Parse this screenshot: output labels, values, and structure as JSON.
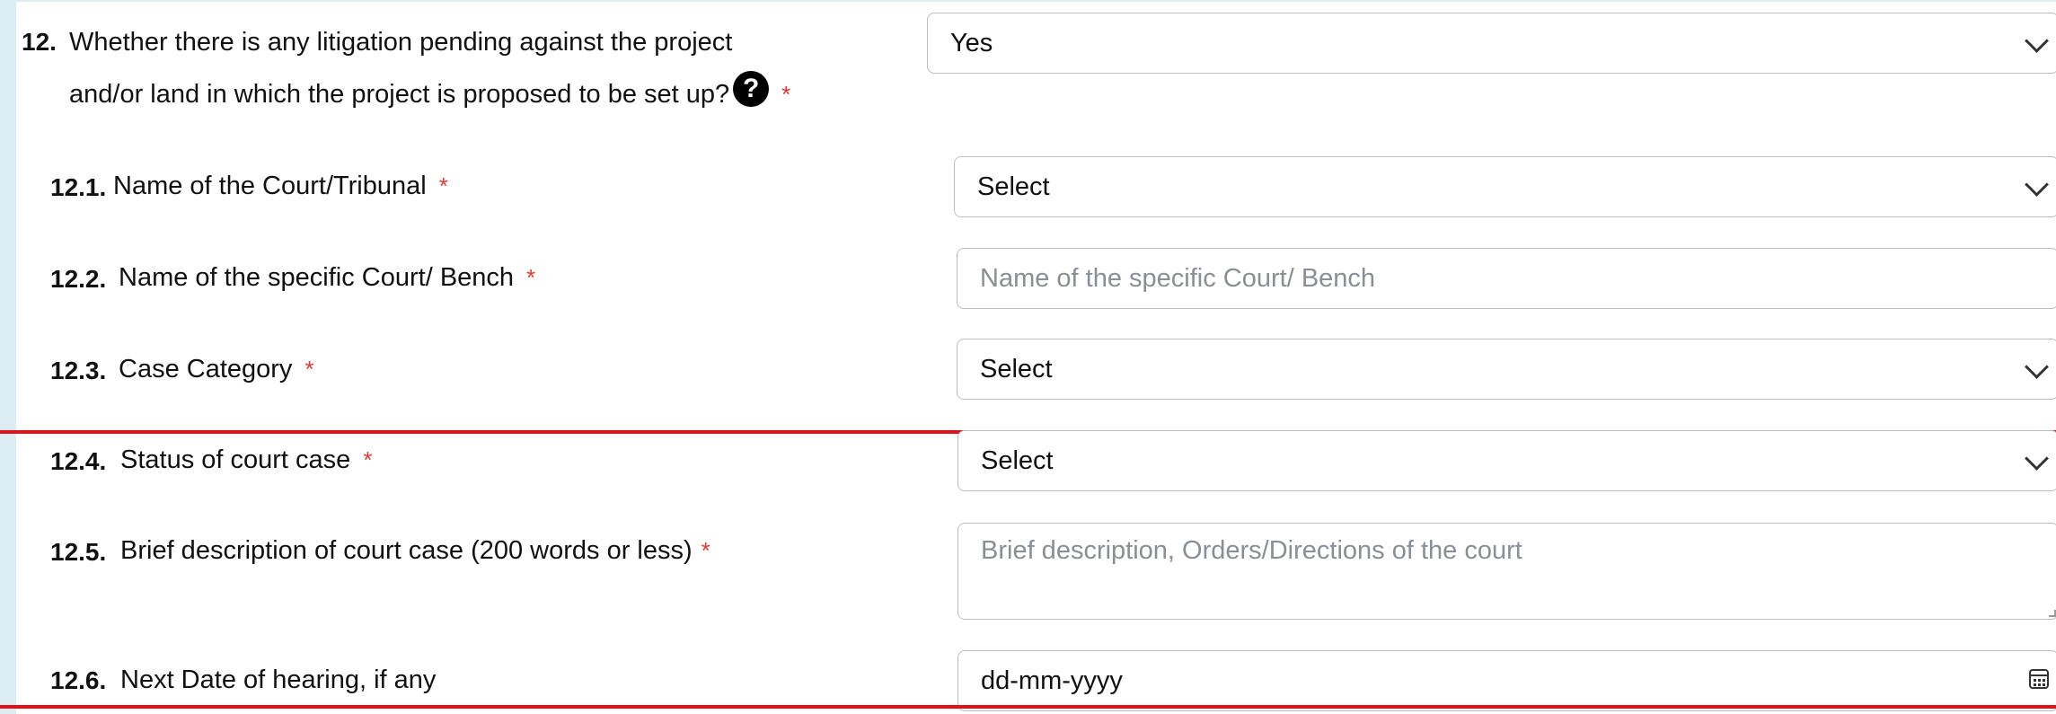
{
  "q12": {
    "number": "12.",
    "line1": "Whether there is any litigation pending against the project",
    "line2": "and/or land in which the project is proposed to be set up?",
    "help_glyph": "?",
    "required": "*",
    "value": "Yes"
  },
  "q12_1": {
    "number": "12.1.",
    "label": "Name of the Court/Tribunal",
    "required": "*",
    "value": "Select"
  },
  "q12_2": {
    "number": "12.2.",
    "label": "Name of the specific Court/ Bench",
    "required": "*",
    "placeholder": "Name of the specific Court/ Bench"
  },
  "q12_3": {
    "number": "12.3.",
    "label": "Case Category",
    "required": "*",
    "value": "Select"
  },
  "q12_4": {
    "number": "12.4.",
    "label": "Status of court case",
    "required": "*",
    "value": "Select"
  },
  "q12_5": {
    "number": "12.5.",
    "label": "Brief description of court case (200 words or less)",
    "required": "*",
    "placeholder": "Brief description, Orders/Directions of the court"
  },
  "q12_6": {
    "number": "12.6.",
    "label": "Next Date of hearing, if any",
    "value": "dd-mm-yyyy"
  },
  "icons": [
    "help-icon",
    "chevron-down-icon",
    "calendar-icon"
  ],
  "colors": {
    "required_star": "#e53935",
    "highlight_border": "#e3101b",
    "side_strip": "#dcedf4",
    "placeholder": "#8a8f96"
  }
}
